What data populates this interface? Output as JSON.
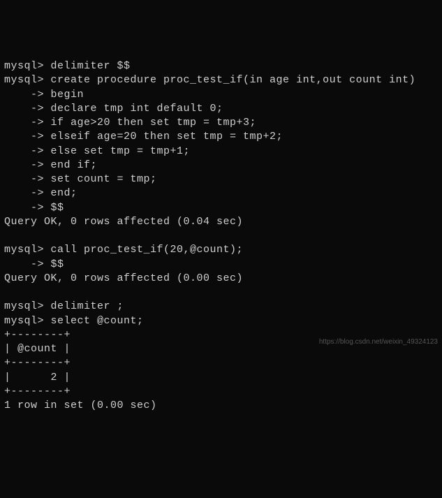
{
  "terminal": {
    "lines": [
      "mysql> delimiter $$",
      "mysql> create procedure proc_test_if(in age int,out count int)",
      "    -> begin",
      "    -> declare tmp int default 0;",
      "    -> if age>20 then set tmp = tmp+3;",
      "    -> elseif age=20 then set tmp = tmp+2;",
      "    -> else set tmp = tmp+1;",
      "    -> end if;",
      "    -> set count = tmp;",
      "    -> end;",
      "    -> $$",
      "Query OK, 0 rows affected (0.04 sec)",
      "",
      "mysql> call proc_test_if(20,@count);",
      "    -> $$",
      "Query OK, 0 rows affected (0.00 sec)",
      "",
      "mysql> delimiter ;",
      "mysql> select @count;",
      "+--------+",
      "| @count |",
      "+--------+",
      "|      2 |",
      "+--------+",
      "1 row in set (0.00 sec)"
    ]
  },
  "watermark": "https://blog.csdn.net/weixin_49324123"
}
